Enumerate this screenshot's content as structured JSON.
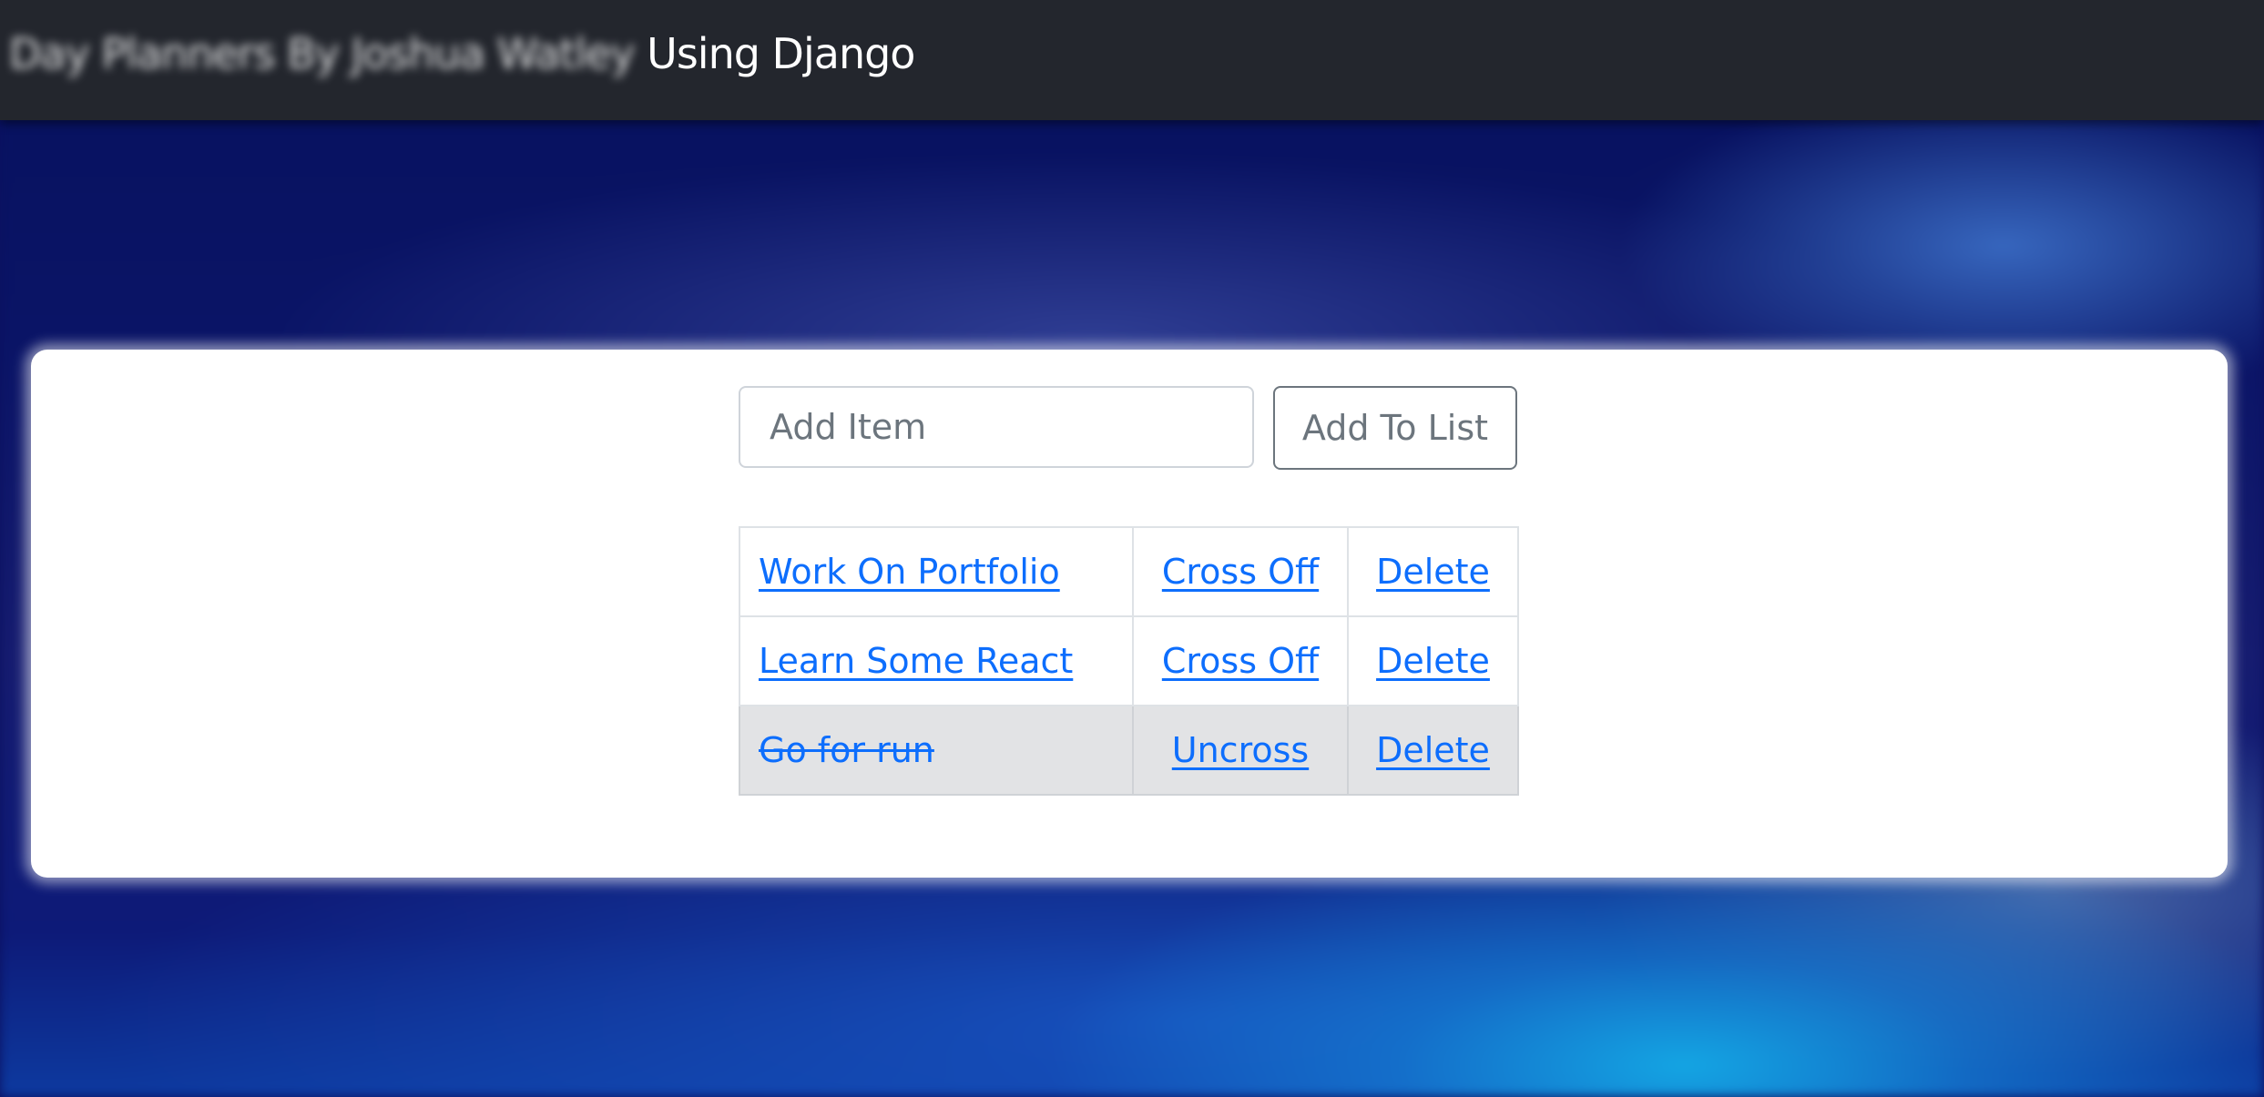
{
  "navbar": {
    "brand_blurred": "Day Planners By Joshua Watley",
    "brand_clear": " Using Django"
  },
  "form": {
    "input_placeholder": "Add Item",
    "input_value": "",
    "submit_label": "Add To List"
  },
  "items": [
    {
      "text": "Work On Portfolio",
      "action": "Cross Off",
      "delete": "Delete",
      "completed": false
    },
    {
      "text": "Learn Some React",
      "action": "Cross Off",
      "delete": "Delete",
      "completed": false
    },
    {
      "text": "Go for run",
      "action": "Uncross",
      "delete": "Delete",
      "completed": true
    }
  ],
  "colors": {
    "navbar": "#23262d",
    "link": "#0d6efd",
    "completed_row": "#e2e3e5",
    "button_border": "#6c757d"
  }
}
